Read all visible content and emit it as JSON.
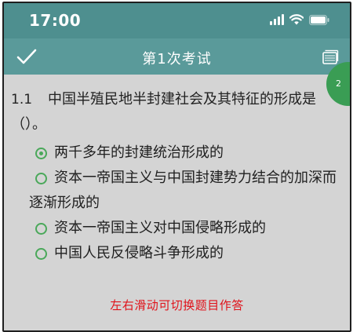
{
  "status_bar": {
    "time": "17:00",
    "icons": [
      "signal-icon",
      "wifi-icon",
      "battery-icon"
    ]
  },
  "nav": {
    "title": "第1次考试",
    "left_icon": "check-icon",
    "right_icon": "cards-icon"
  },
  "progress_badge": {
    "text": "2"
  },
  "question": {
    "number": "1.1",
    "text": "中国半殖民地半封建社会及其特征的形成是（）。"
  },
  "options": [
    {
      "label": "两千多年的封建统治形成的",
      "selected": true
    },
    {
      "label": "资本一帝国主义与中国封建势力结合的加深而逐渐形成的",
      "selected": false
    },
    {
      "label": "资本一帝国主义对中国侵略形成的",
      "selected": false
    },
    {
      "label": "中国人民反侵略斗争形成的",
      "selected": false
    }
  ],
  "hint": "左右滑动可切换题目作答",
  "colors": {
    "status_bar": "#4e8f8f",
    "nav_bar": "#5a9a9a",
    "content_bg": "#d4d4d4",
    "radio": "#4aa85a",
    "badge": "#3a9d54",
    "hint": "#e0121a"
  }
}
